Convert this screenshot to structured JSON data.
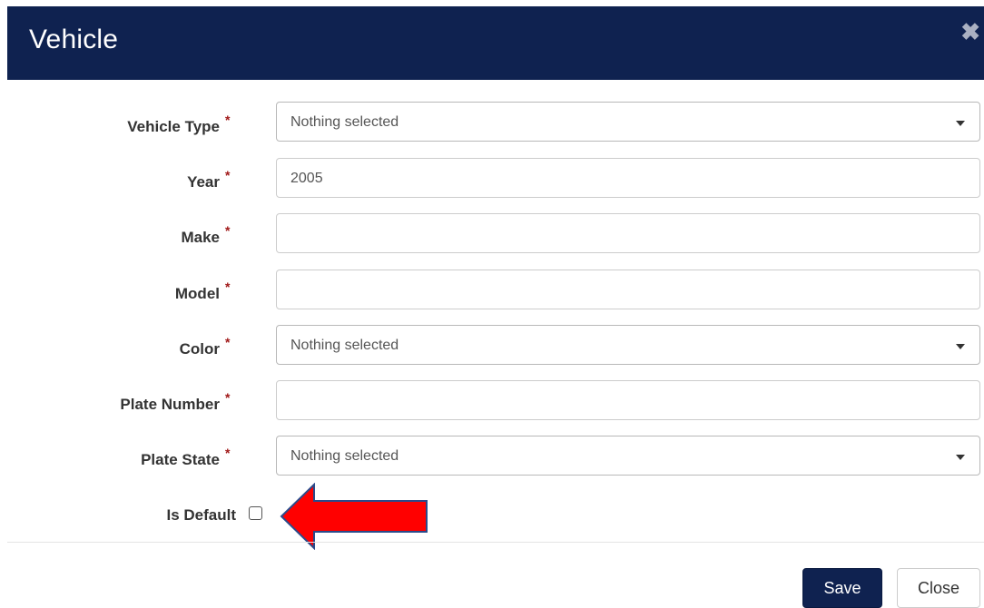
{
  "modal": {
    "title": "Vehicle",
    "close_glyph": "✖"
  },
  "required_marker": "*",
  "fields": [
    {
      "label": "Vehicle Type",
      "type": "select",
      "value": "Nothing selected",
      "required": true
    },
    {
      "label": "Year",
      "type": "text",
      "value": "2005",
      "required": true
    },
    {
      "label": "Make",
      "type": "text",
      "value": "",
      "required": true
    },
    {
      "label": "Model",
      "type": "text",
      "value": "",
      "required": true
    },
    {
      "label": "Color",
      "type": "select",
      "value": "Nothing selected",
      "required": true
    },
    {
      "label": "Plate Number",
      "type": "text",
      "value": "",
      "required": true
    },
    {
      "label": "Plate State",
      "type": "select",
      "value": "Nothing selected",
      "required": true
    }
  ],
  "is_default": {
    "label": "Is Default",
    "checked": false
  },
  "footer": {
    "save_label": "Save",
    "close_label": "Close"
  },
  "colors": {
    "header_bg": "#0f2250",
    "primary_button": "#0f2250",
    "required_marker": "#a01818",
    "annotation_arrow": "#ff0000"
  },
  "annotation": {
    "icon": "red-left-arrow-icon",
    "points_to": "is-default-checkbox"
  }
}
